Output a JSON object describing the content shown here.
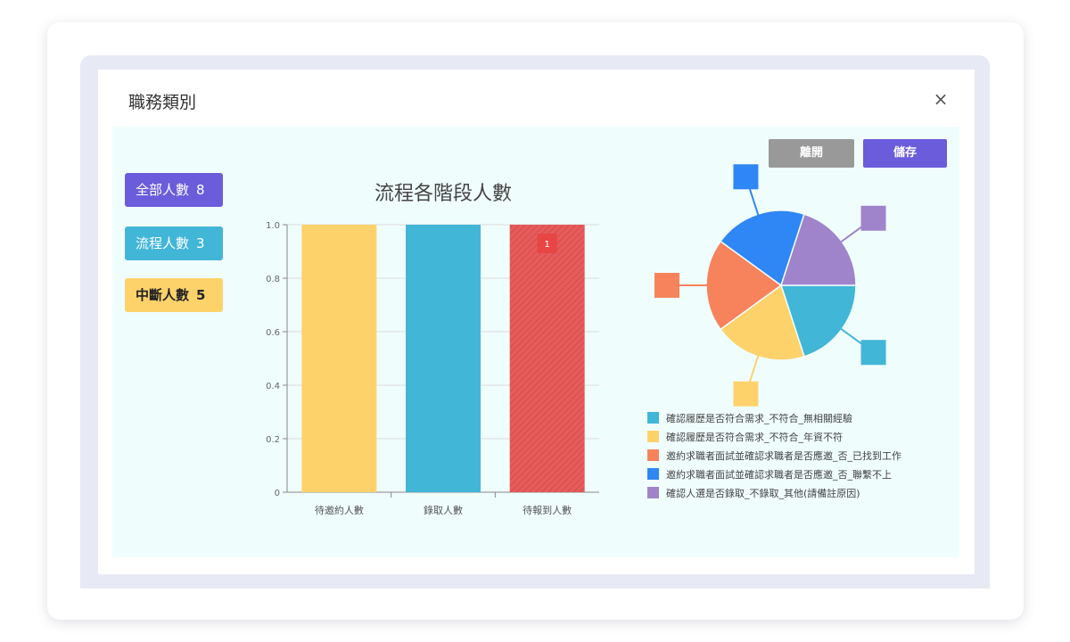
{
  "modal": {
    "title": "職務類別",
    "close_label": "×"
  },
  "actions": {
    "leave_label": "離開",
    "save_label": "儲存"
  },
  "counts": [
    {
      "label": "全部人數",
      "value": "8",
      "color": "#6b5cdb"
    },
    {
      "label": "流程人數",
      "value": "3",
      "color": "#42b6d7"
    },
    {
      "label": "中斷人數",
      "value": "5",
      "color": "#fdd26b"
    }
  ],
  "chart_data": [
    {
      "type": "bar",
      "title": "流程各階段人數",
      "categories": [
        "待邀約人數",
        "錄取人數",
        "待報到人數"
      ],
      "values": [
        1,
        1,
        1
      ],
      "colors": [
        "#fdd26b",
        "#42b6d7",
        "#e85b5b"
      ],
      "ylim": [
        0,
        1
      ],
      "yticks": [
        "0",
        "0.2",
        "0.4",
        "0.6",
        "0.8",
        "1.0"
      ],
      "grid": true,
      "annotations": [
        {
          "category": "待報到人數",
          "text": "1"
        }
      ]
    },
    {
      "type": "pie",
      "title": "",
      "slices": [
        {
          "label": "確認履歷是否符合需求_不符合_無相關經驗",
          "value": 1,
          "color": "#42b6d7"
        },
        {
          "label": "確認履歷是否符合需求_不符合_年資不符",
          "value": 1,
          "color": "#fdd26b"
        },
        {
          "label": "邀約求職者面試並確認求職者是否應邀_否_已找到工作",
          "value": 1,
          "color": "#f6835c"
        },
        {
          "label": "邀約求職者面試並確認求職者是否應邀_否_聯繫不上",
          "value": 1,
          "color": "#2f86f5"
        },
        {
          "label": "確認人選是否錄取_不錄取_其他(請備註原因)",
          "value": 1,
          "color": "#a084cb"
        }
      ],
      "legend_position": "bottom"
    }
  ]
}
